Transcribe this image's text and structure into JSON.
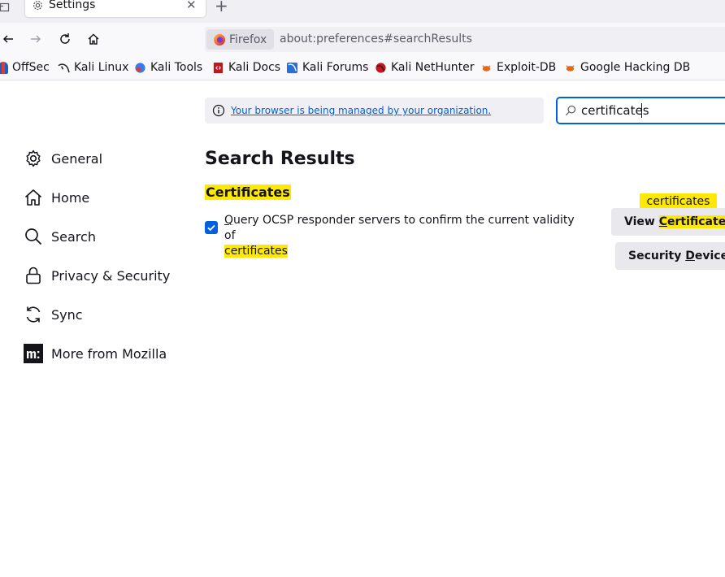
{
  "tab": {
    "title": "Settings",
    "close": "✕"
  },
  "new_tab": "+",
  "urlbar": {
    "identity": "Firefox",
    "url": "about:preferences#searchResults"
  },
  "bookmarks": [
    {
      "label": "OffSec",
      "color": "#1f5fbf"
    },
    {
      "label": "Kali Linux",
      "color": "#222222"
    },
    {
      "label": "Kali Tools",
      "color": "#367bf0"
    },
    {
      "label": "Kali Docs",
      "color": "#c4161c"
    },
    {
      "label": "Kali Forums",
      "color": "#2a6fd6"
    },
    {
      "label": "Kali NetHunter",
      "color": "#c4161c"
    },
    {
      "label": "Exploit-DB",
      "color": "#e06a1b"
    },
    {
      "label": "Google Hacking DB",
      "color": "#e06a1b"
    }
  ],
  "policy": {
    "text": "Your browser is being managed by your organization."
  },
  "search": {
    "value": "certificates"
  },
  "sidebar": {
    "items": [
      {
        "label": "General",
        "icon": "gear-icon"
      },
      {
        "label": "Home",
        "icon": "home-icon"
      },
      {
        "label": "Search",
        "icon": "search-icon"
      },
      {
        "label": "Privacy & Security",
        "icon": "lock-icon"
      },
      {
        "label": "Sync",
        "icon": "sync-icon"
      },
      {
        "label": "More from Mozilla",
        "icon": "mozilla-icon"
      }
    ]
  },
  "main": {
    "heading": "Search Results",
    "section": "Certificates",
    "ocsp": {
      "checked": true,
      "access_key": "Q",
      "label_rest": "uery OCSP responder servers to confirm the current validity of",
      "label_highlight": "certificates"
    },
    "tooltip": "certificates",
    "buttons": {
      "view_prefix": "View ",
      "view_key": "C",
      "view_highlight": "ertificates",
      "view_suffix": "…",
      "sec_prefix": "Security ",
      "sec_key": "D",
      "sec_suffix": "evices…"
    }
  },
  "colors": {
    "accent": "#0061e0",
    "highlight": "#ffe900"
  }
}
